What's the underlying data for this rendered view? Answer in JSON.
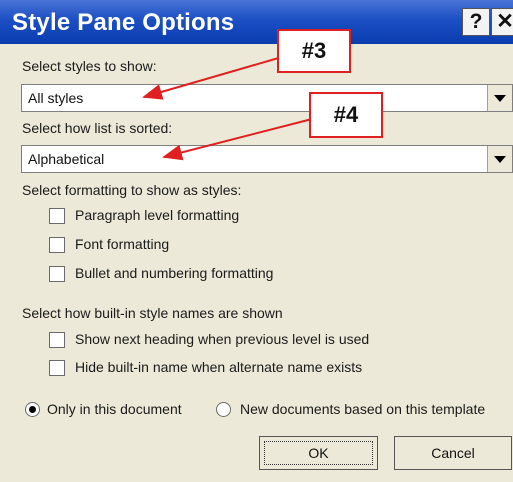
{
  "dialog": {
    "title": "Style Pane Options",
    "help_label": "?",
    "close_label": "✕"
  },
  "styles_section": {
    "label": "Select styles to show:",
    "value": "All styles"
  },
  "sort_section": {
    "label": "Select how list is sorted:",
    "value": "Alphabetical"
  },
  "formatting_section": {
    "label": "Select formatting to show as styles:",
    "options": [
      {
        "label": "Paragraph level formatting",
        "checked": false
      },
      {
        "label": "Font formatting",
        "checked": false
      },
      {
        "label": "Bullet and numbering formatting",
        "checked": false
      }
    ]
  },
  "builtin_section": {
    "label": "Select how built-in style names are shown",
    "options": [
      {
        "label": "Show next heading when previous level is used",
        "checked": false
      },
      {
        "label": "Hide built-in name when alternate name exists",
        "checked": false
      }
    ]
  },
  "scope": {
    "options": [
      {
        "label": "Only in this document",
        "selected": true
      },
      {
        "label": "New documents based on this template",
        "selected": false
      }
    ]
  },
  "buttons": {
    "ok": "OK",
    "cancel": "Cancel"
  },
  "annotations": {
    "first": "#3",
    "second": "#4",
    "color": "#e02020"
  }
}
